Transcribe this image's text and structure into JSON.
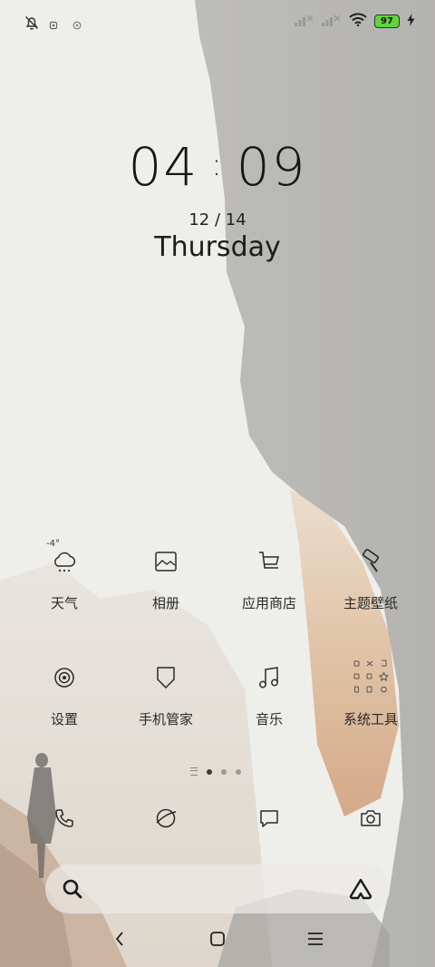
{
  "status_bar": {
    "left_icons": [
      "bell-muted-icon",
      "notification-small-icon",
      "vpn-small-icon"
    ],
    "right_icons": [
      "signal-x-icon",
      "signal-x-icon",
      "wifi-icon",
      "battery-icon",
      "charging-bolt-icon"
    ],
    "battery_level": "97",
    "battery_color": "#5fd43a"
  },
  "clock": {
    "hours": "04",
    "separator": ":",
    "minutes": "09",
    "date": "12 / 14",
    "weekday": "Thursday"
  },
  "home": {
    "row1": [
      {
        "icon": "weather-icon",
        "label": "天气",
        "badge": "-4°"
      },
      {
        "icon": "gallery-icon",
        "label": "相册"
      },
      {
        "icon": "app-store-icon",
        "label": "应用商店"
      },
      {
        "icon": "theme-brush-icon",
        "label": "主题壁纸"
      }
    ],
    "row2": [
      {
        "icon": "settings-icon",
        "label": "设置"
      },
      {
        "icon": "phone-manager-icon",
        "label": "手机管家"
      },
      {
        "icon": "music-icon",
        "label": "音乐"
      },
      {
        "icon": "system-tools-folder-icon",
        "label": "系统工具"
      }
    ],
    "pages": {
      "count": 3,
      "active": 1
    }
  },
  "dock": {
    "icons": [
      "phone-icon",
      "browser-icon",
      "messages-icon",
      "camera-icon"
    ]
  },
  "search_bar": {
    "left_icon": "search-icon",
    "right_icon": "assistant-logo-icon"
  },
  "nav_bar": {
    "icons": [
      "back-icon",
      "home-icon",
      "menu-icon"
    ]
  }
}
